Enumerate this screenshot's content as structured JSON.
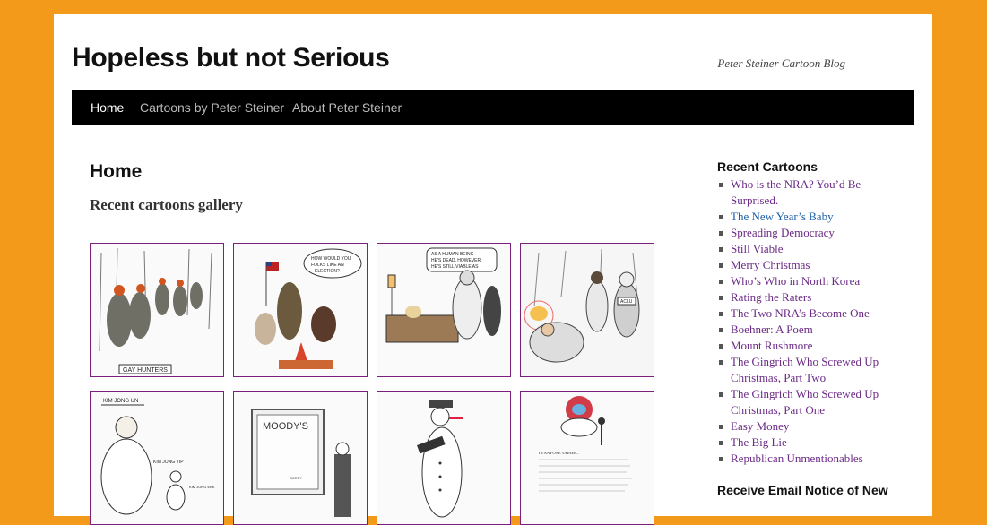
{
  "site": {
    "title": "Hopeless but not Serious",
    "tagline": "Peter Steiner Cartoon Blog"
  },
  "nav": {
    "items": [
      {
        "label": "Home"
      },
      {
        "label": "Cartoons by Peter Steiner"
      },
      {
        "label": "About Peter Steiner"
      }
    ]
  },
  "main": {
    "heading": "Home",
    "subheading": "Recent cartoons gallery",
    "thumbs": [
      {
        "caption": "GAY HUNTERS"
      },
      {
        "caption": "HOW WOULD YOU FOLKS LIKE AN ELECTION?"
      },
      {
        "caption": "AS A HUMAN BEING HE'S DEAD. HOWEVER, HE'S STILL VIABLE AS A CANDIDATE."
      },
      {
        "caption": "ACLU"
      },
      {
        "caption": "KIM JONG UN"
      },
      {
        "caption": "MOODY'S"
      },
      {
        "caption": ""
      },
      {
        "caption": "IN ANYONE VAINER..."
      }
    ]
  },
  "sidebar": {
    "recent_title": "Recent Cartoons",
    "recent": [
      "Who is the NRA? You’d Be Surprised.",
      "The New Year’s Baby",
      "Spreading Democracy",
      "Still Viable",
      "Merry Christmas",
      "Who’s Who in North Korea",
      "Rating the Raters",
      "The Two NRA’s Become One",
      "Boehner: A Poem",
      "Mount Rushmore",
      "The Gingrich Who Screwed Up Christmas, Part Two",
      "The Gingrich Who Screwed Up Christmas, Part One",
      "Easy Money",
      "The Big Lie",
      "Republican Unmentionables"
    ],
    "email_title": "Receive Email Notice of New"
  },
  "colors": {
    "background": "#f39a1a",
    "link": "#6b2a86",
    "link_visited": "#1c5fa8",
    "nav_bg": "#000000"
  }
}
